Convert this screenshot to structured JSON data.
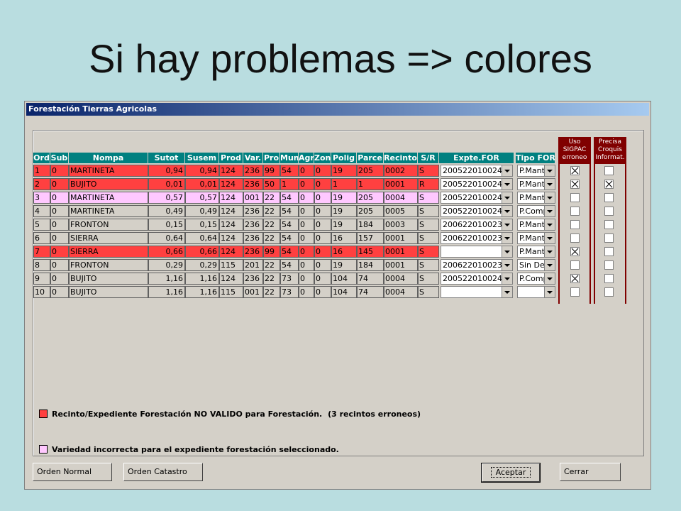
{
  "slide_title": "Si hay problemas => colores",
  "window_title": "Forestación Tierras Agricolas",
  "columns": [
    "Ord",
    "Sub",
    "Nompa",
    "Sutot",
    "Susem",
    "Prod",
    "Var.",
    "Pro",
    "Mun",
    "Agr",
    "Zon",
    "Polig",
    "Parce",
    "Recinto",
    "S/R",
    "Expte.FOR",
    "Tipo FOR"
  ],
  "check_headers": {
    "uso_sigpac": [
      "Uso",
      "SIGPAC",
      "erroneo"
    ],
    "precisa_croquis": [
      "Precisa",
      "Croquis",
      "Informat."
    ]
  },
  "rows": [
    {
      "status": "error",
      "cells": [
        "1",
        "0",
        "MARTINETA",
        "0,94",
        "0,94",
        "124",
        "236",
        "99",
        "54",
        "0",
        "0",
        "19",
        "205",
        "0002",
        "S"
      ],
      "expte": "200522010024",
      "tipo": "P.Mant",
      "uso": true,
      "croquis": false
    },
    {
      "status": "error",
      "cells": [
        "2",
        "0",
        "BUJITO",
        "0,01",
        "0,01",
        "124",
        "236",
        "50",
        "1",
        "0",
        "0",
        "1",
        "1",
        "0001",
        "R"
      ],
      "expte": "200522010024",
      "tipo": "P.Mant",
      "uso": true,
      "croquis": true
    },
    {
      "status": "warn",
      "cells": [
        "3",
        "0",
        "MARTINETA",
        "0,57",
        "0,57",
        "124",
        "001",
        "22",
        "54",
        "0",
        "0",
        "19",
        "205",
        "0004",
        "S"
      ],
      "expte": "200522010024",
      "tipo": "P.Mant",
      "uso": false,
      "croquis": false
    },
    {
      "status": "ok",
      "cells": [
        "4",
        "0",
        "MARTINETA",
        "0,49",
        "0,49",
        "124",
        "236",
        "22",
        "54",
        "0",
        "0",
        "19",
        "205",
        "0005",
        "S"
      ],
      "expte": "200522010024",
      "tipo": "P.Comp",
      "uso": false,
      "croquis": false
    },
    {
      "status": "ok",
      "cells": [
        "5",
        "0",
        "FRONTON",
        "0,15",
        "0,15",
        "124",
        "236",
        "22",
        "54",
        "0",
        "0",
        "19",
        "184",
        "0003",
        "S"
      ],
      "expte": "200622010023",
      "tipo": "P.Mant",
      "uso": false,
      "croquis": false
    },
    {
      "status": "ok",
      "cells": [
        "6",
        "0",
        "SIERRA",
        "0,64",
        "0,64",
        "124",
        "236",
        "22",
        "54",
        "0",
        "0",
        "16",
        "157",
        "0001",
        "S"
      ],
      "expte": "200622010023",
      "tipo": "P.Mant",
      "uso": false,
      "croquis": false
    },
    {
      "status": "error",
      "cells": [
        "7",
        "0",
        "SIERRA",
        "0,66",
        "0,66",
        "124",
        "236",
        "99",
        "54",
        "0",
        "0",
        "16",
        "145",
        "0001",
        "S"
      ],
      "expte": "",
      "tipo": "P.Mant",
      "uso": true,
      "croquis": false
    },
    {
      "status": "ok",
      "cells": [
        "8",
        "0",
        "FRONTON",
        "0,29",
        "0,29",
        "115",
        "201",
        "22",
        "54",
        "0",
        "0",
        "19",
        "184",
        "0001",
        "S"
      ],
      "expte": "200622010023",
      "tipo": "Sin De",
      "uso": false,
      "croquis": false
    },
    {
      "status": "ok",
      "cells": [
        "9",
        "0",
        "BUJITO",
        "1,16",
        "1,16",
        "124",
        "236",
        "22",
        "73",
        "0",
        "0",
        "104",
        "74",
        "0004",
        "S"
      ],
      "expte": "200522010024",
      "tipo": "P.Comp",
      "uso": true,
      "croquis": false
    },
    {
      "status": "ok",
      "cells": [
        "10",
        "0",
        "BUJITO",
        "1,16",
        "1,16",
        "115",
        "001",
        "22",
        "73",
        "0",
        "0",
        "104",
        "74",
        "0004",
        "S"
      ],
      "expte": "",
      "tipo": "",
      "uso": false,
      "croquis": false
    }
  ],
  "legend": {
    "error_text": "Recinto/Expediente Forestación NO VALIDO para Forestación.",
    "error_count": "(3 recintos erroneos)",
    "warn_text": "Variedad incorrecta para el expediente forestación seleccionado."
  },
  "buttons": {
    "orden_normal": "Orden Normal",
    "orden_catastro": "Orden Catastro",
    "aceptar": "Aceptar",
    "cerrar": "Cerrar"
  },
  "colors": {
    "error": "#ff4040",
    "warn": "#ffc8ff",
    "ok": "#d4d0c8",
    "header": "#008080",
    "check_header": "#800000"
  }
}
